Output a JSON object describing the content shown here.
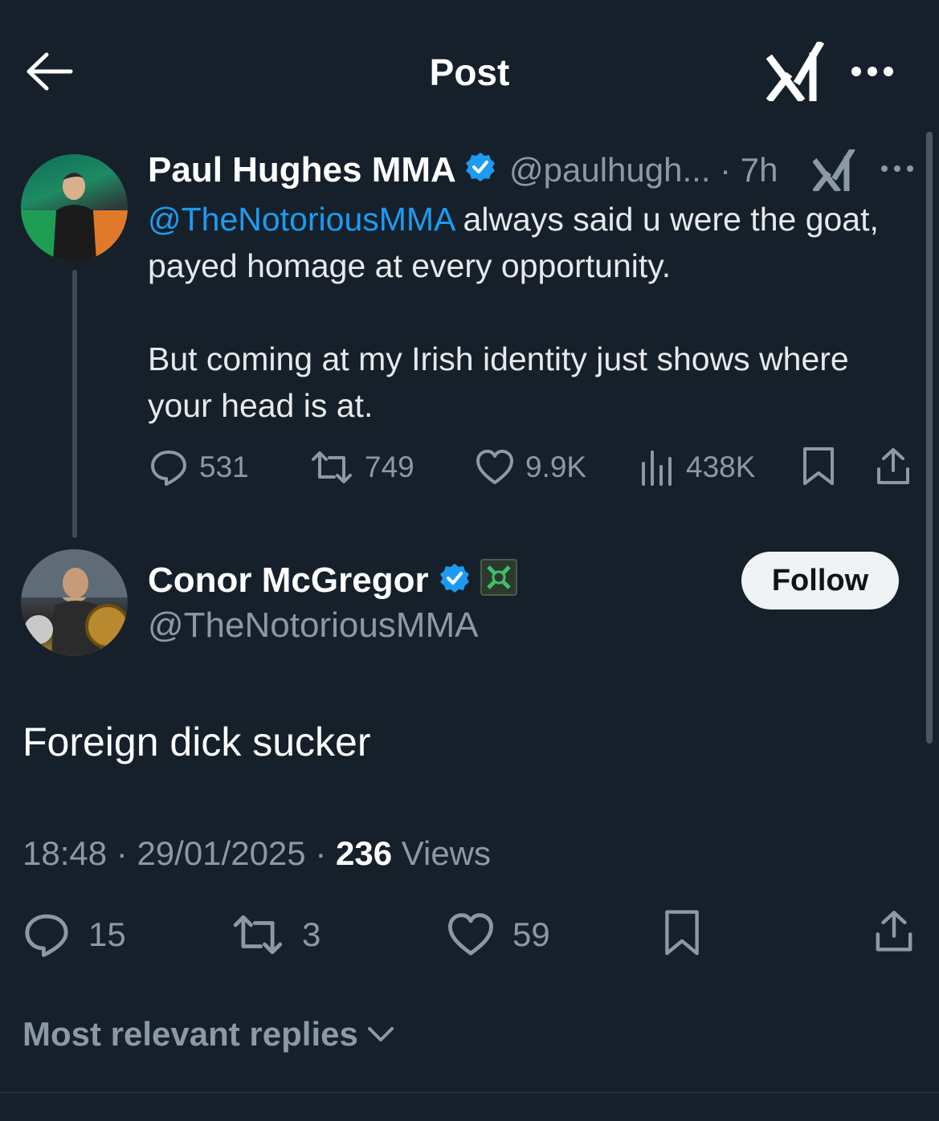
{
  "header": {
    "title": "Post",
    "back_icon": "arrow-left-icon",
    "grok_icon": "grok-icon",
    "more_icon": "more-horizontal-icon"
  },
  "parent_post": {
    "author_name": "Paul Hughes MMA",
    "verified": true,
    "handle_time": "@paulhugh... · 7h",
    "mention": "@TheNotoriousMMA",
    "text_line1_rest": " always said u were the goat, payed homage at every opportunity.",
    "text_para2": "But coming at my Irish identity just shows where your head is at.",
    "replies": "531",
    "reposts": "749",
    "likes": "9.9K",
    "views": "438K"
  },
  "main_post": {
    "author_name": "Conor McGregor",
    "verified": true,
    "affiliate_badge_icon": "affiliate-badge-icon",
    "handle": "@TheNotoriousMMA",
    "follow_label": "Follow",
    "text": "Foreign dick sucker",
    "time": "18:48",
    "date": "29/01/2025",
    "sep": " · ",
    "views_count": "236",
    "views_label": "Views",
    "replies": "15",
    "reposts": "3",
    "likes": "59"
  },
  "replies_sort": {
    "label": "Most relevant replies"
  },
  "colors": {
    "background": "#15202b",
    "accent": "#1d9bf0",
    "muted": "#8b98a5",
    "follow_bg": "#eff3f4"
  }
}
